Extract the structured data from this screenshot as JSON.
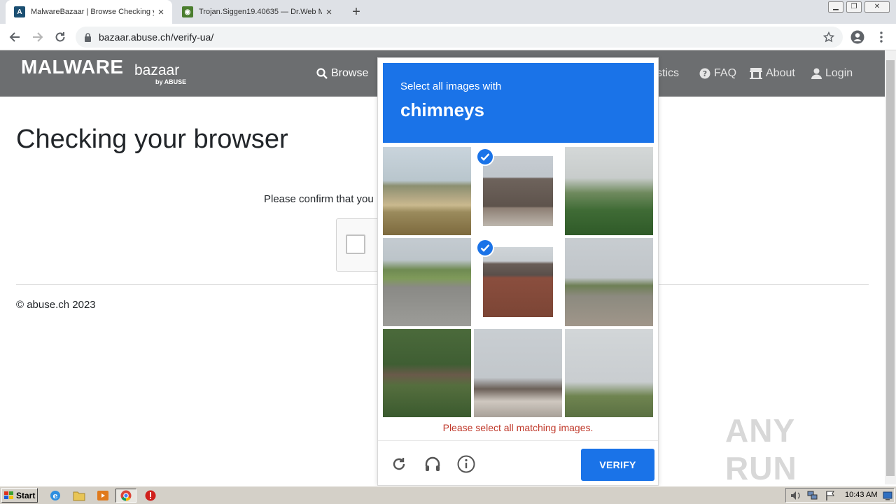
{
  "tabs": [
    {
      "title": "MalwareBazaar | Browse Checking y",
      "favicon": "malwarebazaar-favicon",
      "active": true
    },
    {
      "title": "Trojan.Siggen19.40635 — Dr.Web M",
      "favicon": "drweb-favicon",
      "active": false
    }
  ],
  "address_bar": {
    "url": "bazaar.abuse.ch/verify-ua/"
  },
  "site": {
    "logo_main": "MALWARE",
    "logo_sub": "bazaar",
    "logo_by": "by ABUSE",
    "nav": {
      "browse": "Browse",
      "statistics": "tistics",
      "faq": "FAQ",
      "about": "About",
      "login": "Login"
    },
    "page_title": "Checking your browser",
    "confirm_text": "Please confirm that you",
    "footer": "© abuse.ch 2023"
  },
  "captcha": {
    "prompt_line": "Select all images with",
    "prompt_target": "chimneys",
    "error": "Please select all matching images.",
    "verify_label": "VERIFY",
    "tiles": [
      {
        "index": 1,
        "subject": "grassy roadside landscape",
        "selected": false
      },
      {
        "index": 2,
        "subject": "roof with chimney",
        "selected": true
      },
      {
        "index": 3,
        "subject": "palm tree and shrubs",
        "selected": false
      },
      {
        "index": 4,
        "subject": "curving road with car",
        "selected": false
      },
      {
        "index": 5,
        "subject": "brick house with chimney",
        "selected": true
      },
      {
        "index": 6,
        "subject": "street with sidewalk",
        "selected": false
      },
      {
        "index": 7,
        "subject": "overgrown bridge",
        "selected": false
      },
      {
        "index": 8,
        "subject": "house rooftop",
        "selected": false
      },
      {
        "index": 9,
        "subject": "traffic lights",
        "selected": false
      }
    ]
  },
  "watermark": "ANY RUN",
  "taskbar": {
    "start_label": "Start",
    "clock": "10:43 AM"
  }
}
